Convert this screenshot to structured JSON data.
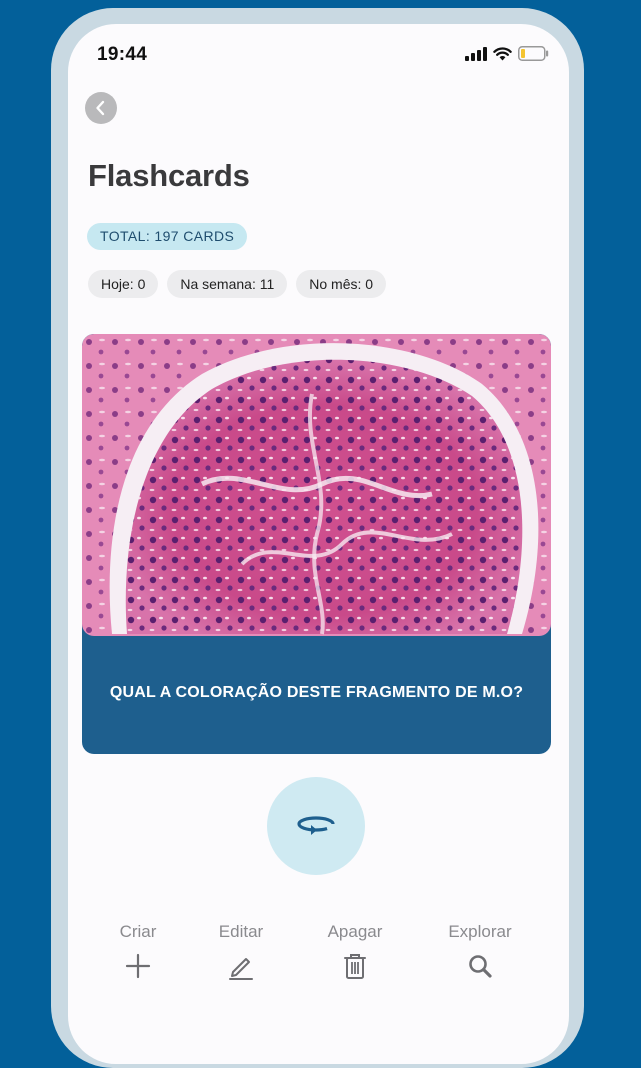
{
  "status_bar": {
    "time": "19:44",
    "icons": [
      "cellular-signal-icon",
      "wifi-icon",
      "battery-icon"
    ]
  },
  "header": {
    "back_icon": "chevron-left-icon",
    "title": "Flashcards"
  },
  "summary": {
    "total_label": "TOTAL: 197 CARDS"
  },
  "stats": [
    {
      "label": "Hoje: 0"
    },
    {
      "label": "Na semana: 11"
    },
    {
      "label": "No mês: 0"
    }
  ],
  "card": {
    "image": "histology-glomerulus-image",
    "question": "QUAL A COLORAÇÃO DESTE FRAGMENTO DE M.O?"
  },
  "flip_button": {
    "icon": "rotate-flip-icon"
  },
  "toolbar": {
    "items": [
      {
        "label": "Criar",
        "icon": "plus-icon"
      },
      {
        "label": "Editar",
        "icon": "pencil-icon"
      },
      {
        "label": "Apagar",
        "icon": "trash-icon"
      },
      {
        "label": "Explorar",
        "icon": "search-icon"
      }
    ]
  },
  "colors": {
    "background": "#03609a",
    "card_footer": "#1e5f8e",
    "badge": "#c6e8f1",
    "flip_button": "#cfeaf2"
  }
}
